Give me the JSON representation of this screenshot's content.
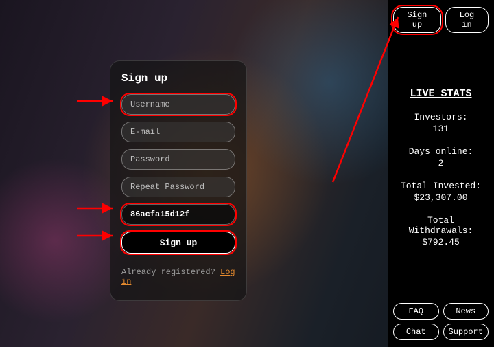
{
  "sidebar": {
    "signup": "Sign up",
    "login": "Log in",
    "stats_title": "LIVE STATS",
    "stats": [
      {
        "label": "Investors:",
        "value": "131"
      },
      {
        "label": "Days online:",
        "value": "2"
      },
      {
        "label": "Total Invested:",
        "value": "$23,307.00"
      },
      {
        "label": "Total Withdrawals:",
        "value": "$792.45"
      }
    ],
    "footer": {
      "faq": "FAQ",
      "news": "News",
      "chat": "Chat",
      "support": "Support"
    }
  },
  "form": {
    "title": "Sign up",
    "username_ph": "Username",
    "email_ph": "E-mail",
    "password_ph": "Password",
    "repeat_ph": "Repeat Password",
    "code_value": "86acfa15d12f",
    "submit": "Sign up",
    "already_text": "Already registered? ",
    "login_link": "Log in"
  },
  "colors": {
    "accent": "#e58a2e",
    "highlight": "#ff0000"
  }
}
